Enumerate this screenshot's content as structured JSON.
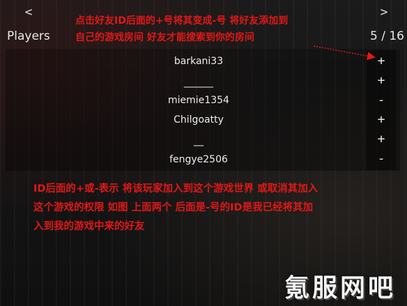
{
  "header": {
    "prev_arrow": "<",
    "next_arrow": ">",
    "players_label": "Players",
    "count": "5 / 16"
  },
  "annotations": {
    "top_line1": "点击好友ID后面的+号将其变成-号  将好友添加到",
    "top_line2": "自己的游戏房间  好友才能搜索到你的房间",
    "bottom_line1": "ID后面的+或-表示  将该玩家加入到这个游戏世界  或取消其加入",
    "bottom_line2": "这个游戏的权限    如图  上面两个  后面是-号的ID是我已经将其加",
    "bottom_line3": "入到我的游戏中来的好友"
  },
  "players": [
    {
      "name": "barkani33",
      "action": "+"
    },
    {
      "name": "______",
      "action": "+"
    },
    {
      "name": "miemie1354",
      "action": "-"
    },
    {
      "name": "Chilgoatty",
      "action": "+"
    },
    {
      "name": "__",
      "action": "+"
    },
    {
      "name": "fengye2506",
      "action": "-"
    }
  ],
  "watermark": "氪服网吧",
  "colors": {
    "annotation": "#e01818",
    "text": "#ececec",
    "background": "#141414"
  }
}
